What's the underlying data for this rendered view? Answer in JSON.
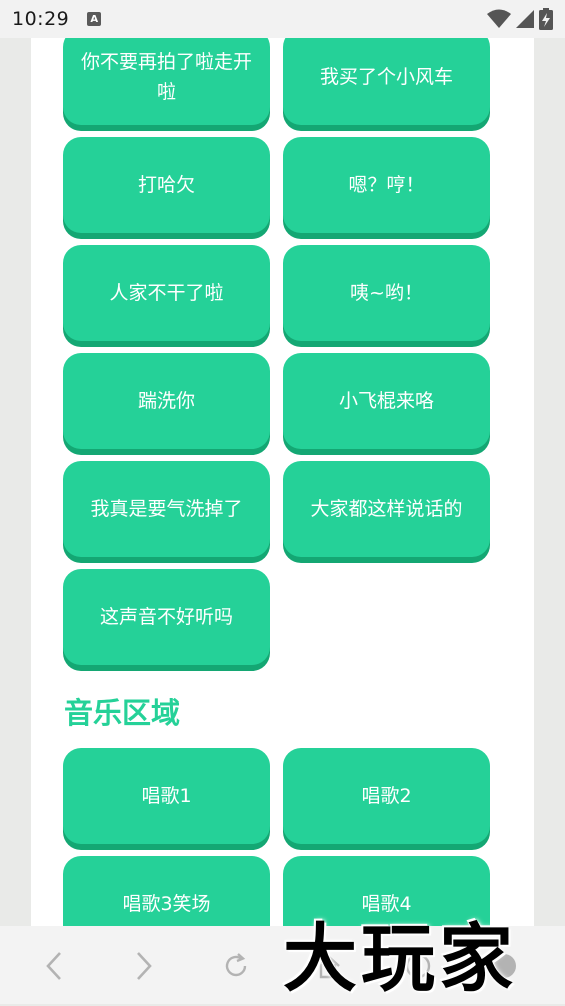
{
  "status_bar": {
    "time": "10:29",
    "notification_icon": "a-badge-icon",
    "icons": [
      "wifi-icon",
      "signal-icon",
      "battery-charging-icon"
    ]
  },
  "voice_buttons": [
    {
      "label": "你不要再拍了啦走开啦"
    },
    {
      "label": "我买了个小风车"
    },
    {
      "label": "打哈欠"
    },
    {
      "label": "嗯？哼！"
    },
    {
      "label": "人家不干了啦"
    },
    {
      "label": "咦~哟！"
    },
    {
      "label": "踹洗你"
    },
    {
      "label": "小飞棍来咯"
    },
    {
      "label": "我真是要气洗掉了"
    },
    {
      "label": "大家都这样说话的"
    },
    {
      "label": "这声音不好听吗"
    }
  ],
  "music_section": {
    "title": "音乐区域",
    "buttons": [
      {
        "label": "唱歌1"
      },
      {
        "label": "唱歌2"
      },
      {
        "label": "唱歌3笑场"
      },
      {
        "label": "唱歌4"
      }
    ]
  },
  "nav_bar": {
    "icons": [
      "back-icon",
      "forward-icon",
      "reload-icon",
      "home-icon",
      "menu-icon",
      "profile-icon"
    ]
  },
  "watermark": {
    "text": "大玩家"
  },
  "colors": {
    "accent": "#25d198",
    "accent_shadow": "#14a773",
    "page_bg": "#ffffff",
    "outer_bg": "#e9eae8"
  }
}
